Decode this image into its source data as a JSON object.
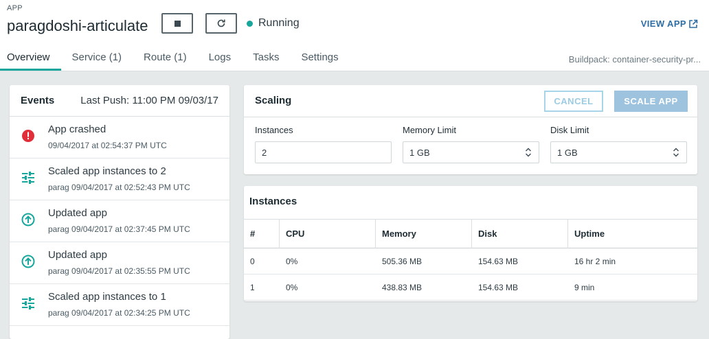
{
  "header": {
    "app_label": "APP",
    "app_name": "paragdoshi-articulate",
    "status": "Running",
    "status_color": "#16a69c",
    "view_app": "VIEW APP",
    "buildpack": "Buildpack: container-security-pr..."
  },
  "tabs": [
    {
      "label": "Overview",
      "active": true
    },
    {
      "label": "Service (1)"
    },
    {
      "label": "Route (1)"
    },
    {
      "label": "Logs"
    },
    {
      "label": "Tasks"
    },
    {
      "label": "Settings"
    }
  ],
  "events": {
    "title": "Events",
    "last_push": "Last Push: 11:00 PM 09/03/17",
    "items": [
      {
        "icon": "error-icon",
        "title": "App crashed",
        "meta": "09/04/2017 at 02:54:37 PM UTC"
      },
      {
        "icon": "sliders-icon",
        "title": "Scaled app instances to 2",
        "meta": "parag 09/04/2017 at 02:52:43 PM UTC"
      },
      {
        "icon": "upload-arrow-icon",
        "title": "Updated app",
        "meta": "parag 09/04/2017 at 02:37:45 PM UTC"
      },
      {
        "icon": "upload-arrow-icon",
        "title": "Updated app",
        "meta": "parag 09/04/2017 at 02:35:55 PM UTC"
      },
      {
        "icon": "sliders-icon",
        "title": "Scaled app instances to 1",
        "meta": "parag 09/04/2017 at 02:34:25 PM UTC"
      }
    ]
  },
  "scaling": {
    "title": "Scaling",
    "cancel": "CANCEL",
    "scale_app": "SCALE APP",
    "instances_label": "Instances",
    "instances_value": "2",
    "memory_label": "Memory Limit",
    "memory_value": "1 GB",
    "disk_label": "Disk Limit",
    "disk_value": "1 GB"
  },
  "instances": {
    "title": "Instances",
    "columns": [
      "#",
      "CPU",
      "Memory",
      "Disk",
      "Uptime"
    ],
    "rows": [
      [
        "0",
        "0%",
        "505.36 MB",
        "154.63 MB",
        "16 hr 2 min"
      ],
      [
        "1",
        "0%",
        "438.83 MB",
        "154.63 MB",
        "9 min"
      ]
    ]
  }
}
